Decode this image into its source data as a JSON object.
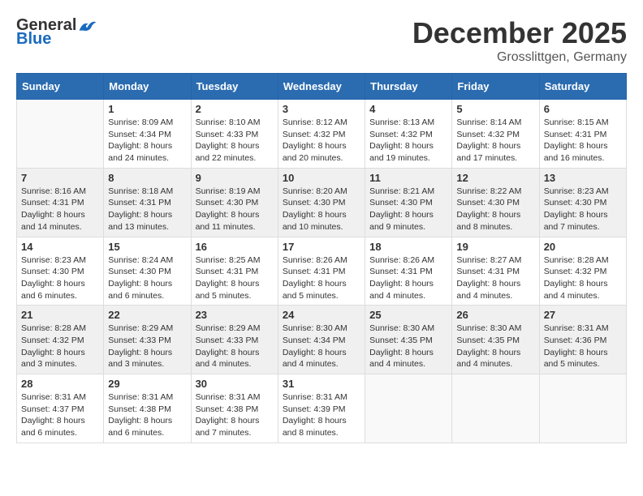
{
  "logo": {
    "general": "General",
    "blue": "Blue"
  },
  "title": "December 2025",
  "location": "Grosslittgen, Germany",
  "weekdays": [
    "Sunday",
    "Monday",
    "Tuesday",
    "Wednesday",
    "Thursday",
    "Friday",
    "Saturday"
  ],
  "weeks": [
    [
      {
        "day": "",
        "sunrise": "",
        "sunset": "",
        "daylight": ""
      },
      {
        "day": "1",
        "sunrise": "Sunrise: 8:09 AM",
        "sunset": "Sunset: 4:34 PM",
        "daylight": "Daylight: 8 hours and 24 minutes."
      },
      {
        "day": "2",
        "sunrise": "Sunrise: 8:10 AM",
        "sunset": "Sunset: 4:33 PM",
        "daylight": "Daylight: 8 hours and 22 minutes."
      },
      {
        "day": "3",
        "sunrise": "Sunrise: 8:12 AM",
        "sunset": "Sunset: 4:32 PM",
        "daylight": "Daylight: 8 hours and 20 minutes."
      },
      {
        "day": "4",
        "sunrise": "Sunrise: 8:13 AM",
        "sunset": "Sunset: 4:32 PM",
        "daylight": "Daylight: 8 hours and 19 minutes."
      },
      {
        "day": "5",
        "sunrise": "Sunrise: 8:14 AM",
        "sunset": "Sunset: 4:32 PM",
        "daylight": "Daylight: 8 hours and 17 minutes."
      },
      {
        "day": "6",
        "sunrise": "Sunrise: 8:15 AM",
        "sunset": "Sunset: 4:31 PM",
        "daylight": "Daylight: 8 hours and 16 minutes."
      }
    ],
    [
      {
        "day": "7",
        "sunrise": "Sunrise: 8:16 AM",
        "sunset": "Sunset: 4:31 PM",
        "daylight": "Daylight: 8 hours and 14 minutes."
      },
      {
        "day": "8",
        "sunrise": "Sunrise: 8:18 AM",
        "sunset": "Sunset: 4:31 PM",
        "daylight": "Daylight: 8 hours and 13 minutes."
      },
      {
        "day": "9",
        "sunrise": "Sunrise: 8:19 AM",
        "sunset": "Sunset: 4:30 PM",
        "daylight": "Daylight: 8 hours and 11 minutes."
      },
      {
        "day": "10",
        "sunrise": "Sunrise: 8:20 AM",
        "sunset": "Sunset: 4:30 PM",
        "daylight": "Daylight: 8 hours and 10 minutes."
      },
      {
        "day": "11",
        "sunrise": "Sunrise: 8:21 AM",
        "sunset": "Sunset: 4:30 PM",
        "daylight": "Daylight: 8 hours and 9 minutes."
      },
      {
        "day": "12",
        "sunrise": "Sunrise: 8:22 AM",
        "sunset": "Sunset: 4:30 PM",
        "daylight": "Daylight: 8 hours and 8 minutes."
      },
      {
        "day": "13",
        "sunrise": "Sunrise: 8:23 AM",
        "sunset": "Sunset: 4:30 PM",
        "daylight": "Daylight: 8 hours and 7 minutes."
      }
    ],
    [
      {
        "day": "14",
        "sunrise": "Sunrise: 8:23 AM",
        "sunset": "Sunset: 4:30 PM",
        "daylight": "Daylight: 8 hours and 6 minutes."
      },
      {
        "day": "15",
        "sunrise": "Sunrise: 8:24 AM",
        "sunset": "Sunset: 4:30 PM",
        "daylight": "Daylight: 8 hours and 6 minutes."
      },
      {
        "day": "16",
        "sunrise": "Sunrise: 8:25 AM",
        "sunset": "Sunset: 4:31 PM",
        "daylight": "Daylight: 8 hours and 5 minutes."
      },
      {
        "day": "17",
        "sunrise": "Sunrise: 8:26 AM",
        "sunset": "Sunset: 4:31 PM",
        "daylight": "Daylight: 8 hours and 5 minutes."
      },
      {
        "day": "18",
        "sunrise": "Sunrise: 8:26 AM",
        "sunset": "Sunset: 4:31 PM",
        "daylight": "Daylight: 8 hours and 4 minutes."
      },
      {
        "day": "19",
        "sunrise": "Sunrise: 8:27 AM",
        "sunset": "Sunset: 4:31 PM",
        "daylight": "Daylight: 8 hours and 4 minutes."
      },
      {
        "day": "20",
        "sunrise": "Sunrise: 8:28 AM",
        "sunset": "Sunset: 4:32 PM",
        "daylight": "Daylight: 8 hours and 4 minutes."
      }
    ],
    [
      {
        "day": "21",
        "sunrise": "Sunrise: 8:28 AM",
        "sunset": "Sunset: 4:32 PM",
        "daylight": "Daylight: 8 hours and 3 minutes."
      },
      {
        "day": "22",
        "sunrise": "Sunrise: 8:29 AM",
        "sunset": "Sunset: 4:33 PM",
        "daylight": "Daylight: 8 hours and 3 minutes."
      },
      {
        "day": "23",
        "sunrise": "Sunrise: 8:29 AM",
        "sunset": "Sunset: 4:33 PM",
        "daylight": "Daylight: 8 hours and 4 minutes."
      },
      {
        "day": "24",
        "sunrise": "Sunrise: 8:30 AM",
        "sunset": "Sunset: 4:34 PM",
        "daylight": "Daylight: 8 hours and 4 minutes."
      },
      {
        "day": "25",
        "sunrise": "Sunrise: 8:30 AM",
        "sunset": "Sunset: 4:35 PM",
        "daylight": "Daylight: 8 hours and 4 minutes."
      },
      {
        "day": "26",
        "sunrise": "Sunrise: 8:30 AM",
        "sunset": "Sunset: 4:35 PM",
        "daylight": "Daylight: 8 hours and 4 minutes."
      },
      {
        "day": "27",
        "sunrise": "Sunrise: 8:31 AM",
        "sunset": "Sunset: 4:36 PM",
        "daylight": "Daylight: 8 hours and 5 minutes."
      }
    ],
    [
      {
        "day": "28",
        "sunrise": "Sunrise: 8:31 AM",
        "sunset": "Sunset: 4:37 PM",
        "daylight": "Daylight: 8 hours and 6 minutes."
      },
      {
        "day": "29",
        "sunrise": "Sunrise: 8:31 AM",
        "sunset": "Sunset: 4:38 PM",
        "daylight": "Daylight: 8 hours and 6 minutes."
      },
      {
        "day": "30",
        "sunrise": "Sunrise: 8:31 AM",
        "sunset": "Sunset: 4:38 PM",
        "daylight": "Daylight: 8 hours and 7 minutes."
      },
      {
        "day": "31",
        "sunrise": "Sunrise: 8:31 AM",
        "sunset": "Sunset: 4:39 PM",
        "daylight": "Daylight: 8 hours and 8 minutes."
      },
      {
        "day": "",
        "sunrise": "",
        "sunset": "",
        "daylight": ""
      },
      {
        "day": "",
        "sunrise": "",
        "sunset": "",
        "daylight": ""
      },
      {
        "day": "",
        "sunrise": "",
        "sunset": "",
        "daylight": ""
      }
    ]
  ]
}
